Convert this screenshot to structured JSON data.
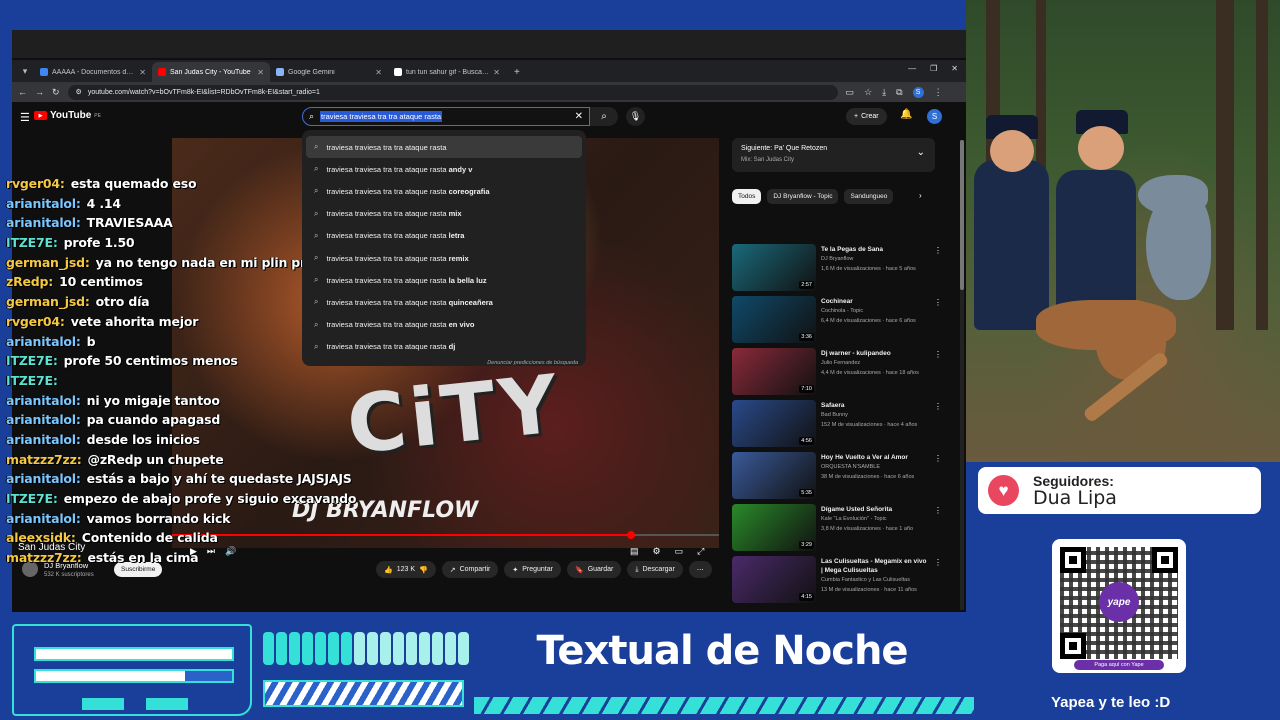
{
  "browser": {
    "tabs": [
      {
        "label": "AAAAA - Documentos de Goo",
        "color": "#4285f4",
        "active": false
      },
      {
        "label": "San Judas City - YouTube",
        "color": "#ff0000",
        "active": true
      },
      {
        "label": "Google Gemini",
        "color": "#8ab4f8",
        "active": false
      },
      {
        "label": "tun tun sahur gif - Buscar con G",
        "color": "#ffffff",
        "active": false
      }
    ],
    "url": "youtube.com/watch?v=bOvTFm8k-EI&list=RDbOvTFm8k-EI&start_radio=1"
  },
  "youtube": {
    "logo_text": "YouTube",
    "region": "PE",
    "search_query": "traviesa traviesa tra tra ataque rasta",
    "create_label": "Crear",
    "avatar_letter": "S",
    "suggestions": [
      {
        "base": "traviesa traviesa tra tra ataque rasta",
        "extra": ""
      },
      {
        "base": "traviesa traviesa tra tra ataque rasta ",
        "extra": "andy v"
      },
      {
        "base": "traviesa traviesa tra tra ataque rasta ",
        "extra": "coreografia"
      },
      {
        "base": "traviesa traviesa tra tra ataque rasta ",
        "extra": "mix"
      },
      {
        "base": "traviesa traviesa tra tra ataque rasta ",
        "extra": "letra"
      },
      {
        "base": "traviesa traviesa tra tra ataque rasta ",
        "extra": "remix"
      },
      {
        "base": "traviesa traviesa tra tra ataque rasta ",
        "extra": "la bella luz"
      },
      {
        "base": "traviesa traviesa tra tra ataque rasta ",
        "extra": "quinceañera"
      },
      {
        "base": "traviesa traviesa tra tra ataque rasta ",
        "extra": "en vivo"
      },
      {
        "base": "traviesa traviesa tra tra ataque rasta ",
        "extra": "dj"
      }
    ],
    "report_predictions": "Denunciar predicciones de búsqueda",
    "video": {
      "art_text": "CiTY",
      "art_credit": "DJ BRYANFLOW",
      "progress_fraction": 0.84,
      "title": "San Judas City"
    },
    "channel": {
      "name": "DJ Bryanflow",
      "subs": "532 K suscriptores",
      "subscribe_label": "Suscribirme"
    },
    "actions": {
      "likes": "123 K",
      "share": "Compartir",
      "ask": "Preguntar",
      "save": "Guardar",
      "download": "Descargar"
    },
    "up_next": {
      "title": "Siguiente: Pa' Que Retozen",
      "subtitle": "Mix: San Judas City"
    },
    "chips": [
      "Todos",
      "DJ Bryanflow - Topic",
      "Sandungueo"
    ],
    "recommendations": [
      {
        "title": "Te la Pegas de Sana",
        "channel": "DJ Bryanflow",
        "meta": "1,6 M de visualizaciones · hace 5 años",
        "duration": "2:57",
        "thumb": "#1a6a7a"
      },
      {
        "title": "Cochinear",
        "channel": "Cochinola - Topic",
        "meta": "6,4 M de visualizaciones · hace 6 años",
        "duration": "3:36",
        "thumb": "#0f4a6a"
      },
      {
        "title": "Dj warner - kulipandeo",
        "channel": "Julio Fernandez",
        "meta": "4,4 M de visualizaciones · hace 18 años",
        "duration": "7:10",
        "thumb": "#8a2a3a"
      },
      {
        "title": "Safaera",
        "channel": "Bad Bunny",
        "meta": "152 M de visualizaciones · hace 4 años",
        "duration": "4:56",
        "thumb": "#2a4a8a"
      },
      {
        "title": "Hoy He Vuelto a Ver al Amor",
        "channel": "ORQUESTA N'SAMBLE",
        "meta": "38 M de visualizaciones · hace 6 años",
        "duration": "5:35",
        "thumb": "#3a5a9a"
      },
      {
        "title": "Dígame Usted Señorita",
        "channel": "Kale \"La Evolución\" - Topic",
        "meta": "3,8 M de visualizaciones · hace 1 año",
        "duration": "3:29",
        "thumb": "#2a8a2a"
      },
      {
        "title": "Las Culisueltas - Megamix en vivo | Mega Culisueltas",
        "channel": "Cumbia Fantastico y Las Culisueltas",
        "meta": "13 M de visualizaciones · hace 11 años",
        "duration": "4:15",
        "thumb": "#4a2a6a"
      }
    ]
  },
  "chat": [
    {
      "user": "rvger04:",
      "color": "#f5c842",
      "msg": "esta quemado eso"
    },
    {
      "user": "arianitalol:",
      "color": "#7ac8ff",
      "msg": "4 .14"
    },
    {
      "user": "arianitalol:",
      "color": "#7ac8ff",
      "msg": "TRAVIESAAA"
    },
    {
      "user": "ITZE7E:",
      "color": "#5ce0d0",
      "msg": "profe 1.50"
    },
    {
      "user": "german_jsd:",
      "color": "#f5c842",
      "msg": "ya no tengo nada en mi plin profe"
    },
    {
      "user": "zRedp:",
      "color": "#f5c842",
      "msg": "10 centimos"
    },
    {
      "user": "german_jsd:",
      "color": "#f5c842",
      "msg": "otro día"
    },
    {
      "user": "rvger04:",
      "color": "#f5c842",
      "msg": "vete ahorita mejor"
    },
    {
      "user": "arianitalol:",
      "color": "#7ac8ff",
      "msg": "b"
    },
    {
      "user": "ITZE7E:",
      "color": "#5ce0d0",
      "msg": "profe 50 centimos menos"
    },
    {
      "user": "ITZE7E:",
      "color": "#5ce0d0",
      "msg": ""
    },
    {
      "user": "arianitalol:",
      "color": "#7ac8ff",
      "msg": "ni yo migaje tantoo"
    },
    {
      "user": "arianitalol:",
      "color": "#7ac8ff",
      "msg": "pa cuando apagasd"
    },
    {
      "user": "arianitalol:",
      "color": "#7ac8ff",
      "msg": "desde los inicios"
    },
    {
      "user": "matzzz7zz:",
      "color": "#f5c842",
      "msg": "@zRedp un chupete"
    },
    {
      "user": "arianitalol:",
      "color": "#7ac8ff",
      "msg": "estás a bajo y ahí te quedaste JAJSJAJS"
    },
    {
      "user": "ITZE7E:",
      "color": "#5ce0d0",
      "msg": "empezo de abajo profe y siguio excavando"
    },
    {
      "user": "arianitalol:",
      "color": "#7ac8ff",
      "msg": "vamos borrando kick"
    },
    {
      "user": "aleexsidk:",
      "color": "#f5c842",
      "msg": "Contenido de calida"
    },
    {
      "user": "matzzz7zz:",
      "color": "#f5c842",
      "msg": "estás en la cima"
    }
  ],
  "stream": {
    "followers_label": "Seguidores:",
    "followers_name": "Dua Lipa",
    "qr_logo": "yape",
    "qr_caption": "Paga aquí con Yape",
    "yape_text": "Yapea y te leo :D",
    "headline": "Textual de Noche",
    "bar_a_fraction": 1.0,
    "bar_b_fraction": 0.76,
    "level_bars_on": 7,
    "level_bars_total": 16,
    "accent": "#34e0d8",
    "background": "#1a3f9a"
  }
}
